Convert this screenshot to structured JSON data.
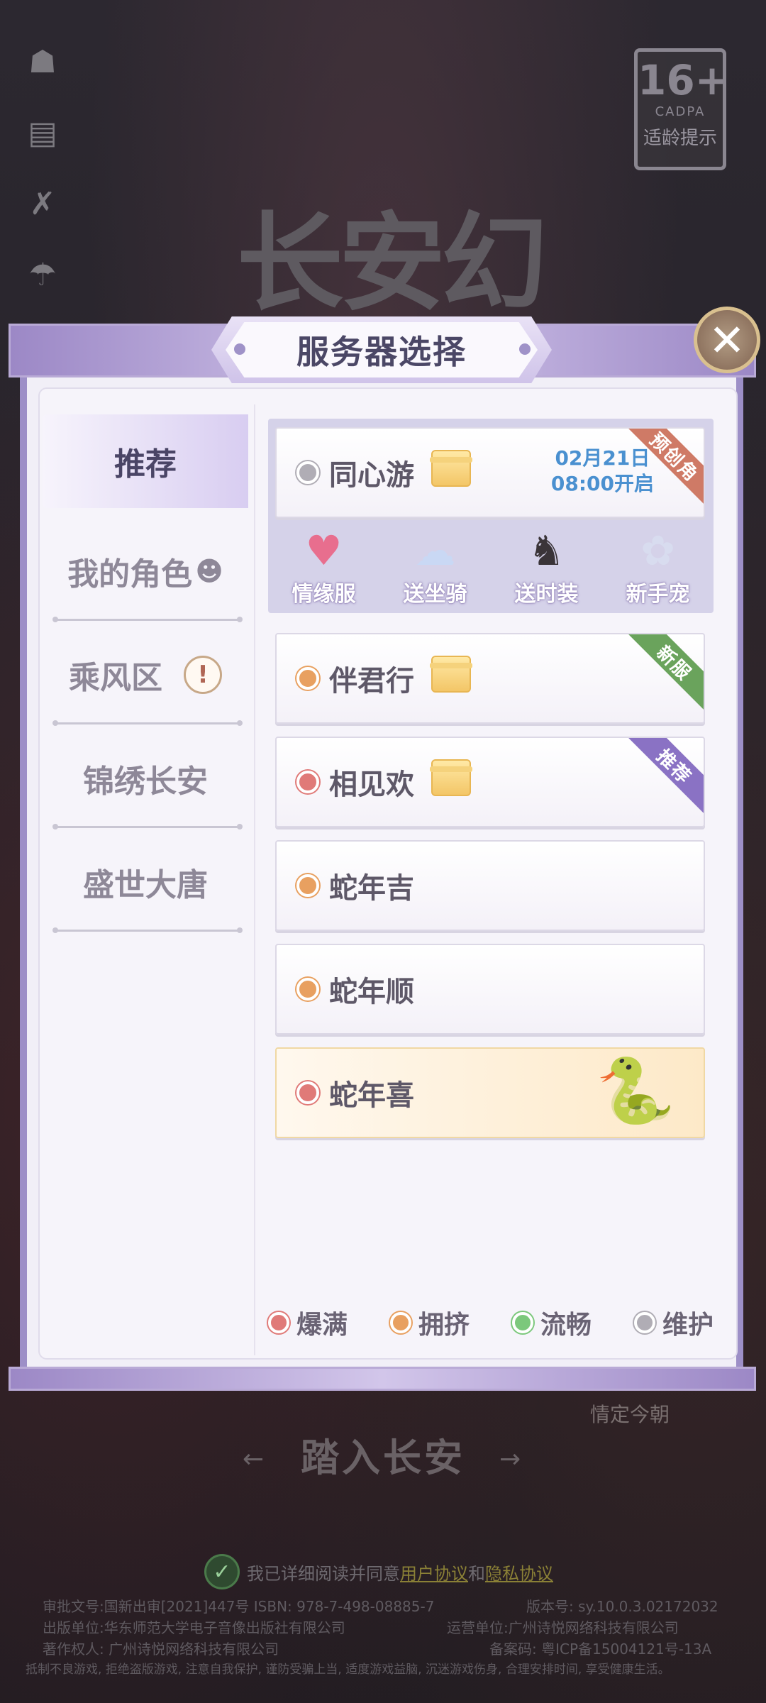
{
  "age_rating": {
    "number": "16+",
    "org": "CADPA",
    "tip": "适龄提示"
  },
  "game_logo": "长安幻想",
  "modal": {
    "title": "服务器选择",
    "close_symbol": "✕"
  },
  "tabs": [
    {
      "label": "推荐",
      "active": true
    },
    {
      "label": "我的角色",
      "icon": "character-icon"
    },
    {
      "label": "乘风区",
      "badge": "!"
    },
    {
      "label": "锦绣长安"
    },
    {
      "label": "盛世大唐"
    }
  ],
  "featured": {
    "name": "同心游",
    "status": "maintenance",
    "open_date": "02月21日",
    "open_time": "08:00开启",
    "ribbon": "预创角",
    "perks": [
      "情缘服",
      "送坐骑",
      "送时装",
      "新手宠"
    ]
  },
  "servers": [
    {
      "name": "伴君行",
      "status": "crowded",
      "gift": true,
      "ribbon": "新服"
    },
    {
      "name": "相见欢",
      "status": "full",
      "gift": true,
      "ribbon": "推荐"
    },
    {
      "name": "蛇年吉",
      "status": "crowded"
    },
    {
      "name": "蛇年顺",
      "status": "crowded"
    },
    {
      "name": "蛇年喜",
      "status": "full",
      "special": true
    }
  ],
  "legend": [
    {
      "label": "爆满",
      "color": "#e07a78"
    },
    {
      "label": "拥挤",
      "color": "#e8a060"
    },
    {
      "label": "流畅",
      "color": "#7cc87c"
    },
    {
      "label": "维护",
      "color": "#b0adb5"
    }
  ],
  "colors": {
    "ribbon_new": "#6aa35c",
    "ribbon_recommend": "#8a72c4",
    "ribbon_precreate": "#cf7a66"
  },
  "signature": "情定今朝",
  "enter_button": "踏入长安",
  "agreement": {
    "prefix": "我已详细阅读并同意",
    "user_agreement": "用户协议",
    "and": "和",
    "privacy_agreement": "隐私协议"
  },
  "footer": {
    "approval": "审批文号:国新出审[2021]447号  ISBN: 978-7-498-08885-7",
    "version": "版本号: sy.10.0.3.02172032",
    "publisher": "出版单位:华东师范大学电子音像出版社有限公司",
    "operator": "运营单位:广州诗悦网络科技有限公司",
    "copyright": "著作权人: 广州诗悦网络科技有限公司",
    "icp": "备案码: 粤ICP备15004121号-13A",
    "health_notice": "抵制不良游戏, 拒绝盗版游戏, 注意自我保护, 谨防受骗上当, 适度游戏益脑, 沉迷游戏伤身, 合理安排时间, 享受健康生活。"
  }
}
